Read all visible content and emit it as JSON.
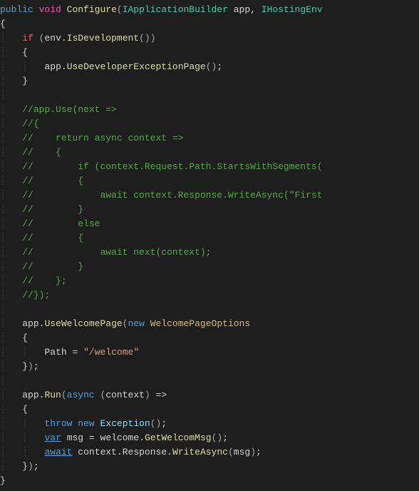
{
  "code": {
    "l1_public": "public",
    "l1_void": "void",
    "l1_method": "Configure",
    "l1_type1": "IApplicationBuilder",
    "l1_arg1": "app",
    "l1_type2": "IHostingEnv",
    "l3_if": "if",
    "l3_env": "env",
    "l3_isdev": "IsDevelopment",
    "l5_app": "app",
    "l5_method": "UseDeveloperExceptionPage",
    "c1": "//app.Use(next =>",
    "c2": "//{",
    "c3": "//    return async context =>",
    "c4": "//    {",
    "c5": "//        if (context.Request.Path.StartsWithSegments(",
    "c6": "//        {",
    "c7": "//            await context.Response.WriteAsync(\"First",
    "c8": "//        }",
    "c9": "//        else",
    "c10": "//        {",
    "c11": "//            await next(context);",
    "c12": "//        }",
    "c13": "//    };",
    "c14": "//});",
    "w_app": "app",
    "w_method": "UseWelcomePage",
    "w_new": "new",
    "w_type": "WelcomePageOptions",
    "w_prop": "Path",
    "w_string": "\"/welcome\"",
    "r_app": "app",
    "r_method": "Run",
    "r_async": "async",
    "r_ctx": "context",
    "t_throw": "throw",
    "t_new": "new",
    "t_exc": "Exception",
    "v_var": "var",
    "v_msg": "msg",
    "v_welcome": "welcome",
    "v_method": "GetWelcomMsg",
    "a_await": "await",
    "a_ctx": "context",
    "a_resp": "Response",
    "a_method": "WriteAsync",
    "a_arg": "msg"
  }
}
